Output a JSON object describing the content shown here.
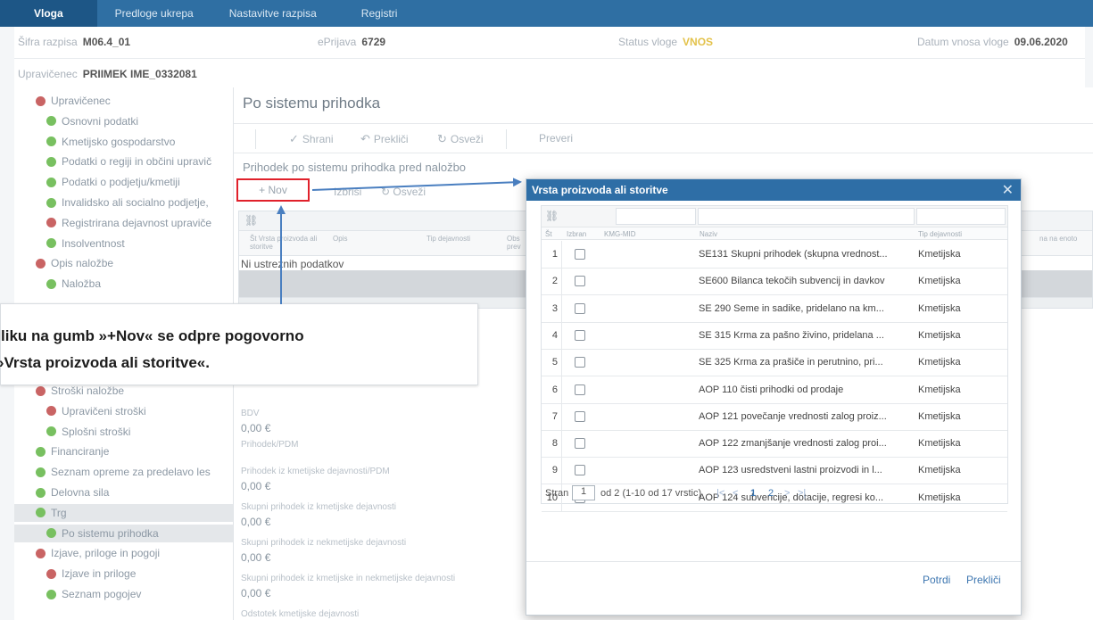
{
  "topnav": [
    "Vloga",
    "Predloge ukrepa",
    "Nastavitve razpisa",
    "Registri"
  ],
  "header": {
    "sifra_label": "Šifra razpisa",
    "sifra_value": "M06.4_01",
    "eprijava_label": "ePrijava",
    "eprijava_value": "6729",
    "status_label": "Status vloge",
    "status_value": "VNOS",
    "datum_label": "Datum vnosa vloge",
    "datum_value": "09.06.2020",
    "upr_label": "Upravičenec",
    "upr_value": "PRIIMEK IME_0332081"
  },
  "sidebar": [
    {
      "label": "Upravičenec",
      "dot": "red"
    },
    {
      "label": "Osnovni podatki",
      "dot": "green"
    },
    {
      "label": "Kmetijsko gospodarstvo",
      "dot": "green"
    },
    {
      "label": "Podatki o regiji in občini upravič",
      "dot": "green"
    },
    {
      "label": "Podatki o podjetju/kmetiji",
      "dot": "green"
    },
    {
      "label": "Invalidsko ali socialno podjetje,",
      "dot": "green"
    },
    {
      "label": "Registrirana dejavnost upraviče",
      "dot": "red"
    },
    {
      "label": "Insolventnost",
      "dot": "green"
    },
    {
      "label": "Opis naložbe",
      "dot": "red"
    },
    {
      "label": "Naložba",
      "dot": "green"
    },
    {
      "label": "Stroški naložbe",
      "dot": "red"
    },
    {
      "label": "Upravičeni stroški",
      "dot": "red"
    },
    {
      "label": "Splošni stroški",
      "dot": "green"
    },
    {
      "label": "Financiranje",
      "dot": "green"
    },
    {
      "label": "Seznam opreme za predelavo les",
      "dot": "green"
    },
    {
      "label": "Delovna sila",
      "dot": "green"
    },
    {
      "label": "Trg",
      "dot": "green"
    },
    {
      "label": "Po sistemu prihodka",
      "dot": "green"
    },
    {
      "label": "Izjave, priloge in pogoji",
      "dot": "red"
    },
    {
      "label": "Izjave in priloge",
      "dot": "red"
    },
    {
      "label": "Seznam pogojev",
      "dot": "green"
    }
  ],
  "main": {
    "title": "Po sistemu prihodka",
    "toolbar": {
      "save": "Shrani",
      "cancel": "Prekliči",
      "refresh": "Osveži",
      "check": "Preveri"
    },
    "subtitle": "Prihodek po sistemu prihodka pred naložbo",
    "grid_toolbar": {
      "new": "+ Nov",
      "delete": "Izbriši",
      "refresh": "Osveži"
    },
    "grid_headers": [
      "Št Vrsta proizvoda ali storitve",
      "Opis",
      "Tip dejavnosti",
      "Obs prev",
      "na na enoto"
    ],
    "grid_empty": "Ni ustreznih podatkov",
    "fields": [
      {
        "label": "BDV",
        "value": "0,00 €"
      },
      {
        "label": "Prihodek/PDM",
        "value": ""
      },
      {
        "label": "Prihodek iz kmetijske dejavnosti/PDM",
        "value": "0,00 €"
      },
      {
        "label": "Skupni prihodek iz kmetijske dejavnosti",
        "value": "0,00 €"
      },
      {
        "label": "Skupni prihodek iz nekmetijske dejavnosti",
        "value": "0,00 €"
      },
      {
        "label": "Skupni prihodek iz kmetijske in nekmetijske dejavnosti",
        "value": "0,00 €"
      },
      {
        "label": "Odstotek kmetijske dejavnosti",
        "value": ""
      }
    ]
  },
  "callout": {
    "line1": "liku na gumb »+Nov« se odpre pogovorno",
    "line2": "»Vrsta proizvoda ali storitve«."
  },
  "modal": {
    "title": "Vrsta proizvoda ali storitve",
    "headers": {
      "num": "Št",
      "izbran": "Izbran",
      "kmg": "KMG-MID",
      "naziv": "Naziv",
      "tip": "Tip dejavnosti"
    },
    "rows": [
      {
        "num": "1",
        "naziv": "SE131 Skupni prihodek (skupna vrednost...",
        "tip": "Kmetijska"
      },
      {
        "num": "2",
        "naziv": "SE600 Bilanca tekočih subvencij in davkov",
        "tip": "Kmetijska"
      },
      {
        "num": "3",
        "naziv": "SE 290 Seme in sadike, pridelano na km...",
        "tip": "Kmetijska"
      },
      {
        "num": "4",
        "naziv": "SE 315 Krma za pašno živino, pridelana ...",
        "tip": "Kmetijska"
      },
      {
        "num": "5",
        "naziv": "SE 325 Krma za prašiče in perutnino, pri...",
        "tip": "Kmetijska"
      },
      {
        "num": "6",
        "naziv": "AOP 110 čisti prihodki od prodaje",
        "tip": "Kmetijska"
      },
      {
        "num": "7",
        "naziv": "AOP 121 povečanje vrednosti zalog proiz...",
        "tip": "Kmetijska"
      },
      {
        "num": "8",
        "naziv": "AOP 122 zmanjšanje vrednosti zalog proi...",
        "tip": "Kmetijska"
      },
      {
        "num": "9",
        "naziv": "AOP 123 usredstveni lastni proizvodi in l...",
        "tip": "Kmetijska"
      },
      {
        "num": "10",
        "naziv": "AOP 124 subvencije, dotacije, regresi ko...",
        "tip": "Kmetijska"
      }
    ],
    "pager": {
      "label": "Stran",
      "page": "1",
      "info": "od 2 (1-10 od 17 vrstic)",
      "p1": "1",
      "p2": "2"
    },
    "confirm": "Potrdi",
    "cancel": "Prekliči"
  }
}
